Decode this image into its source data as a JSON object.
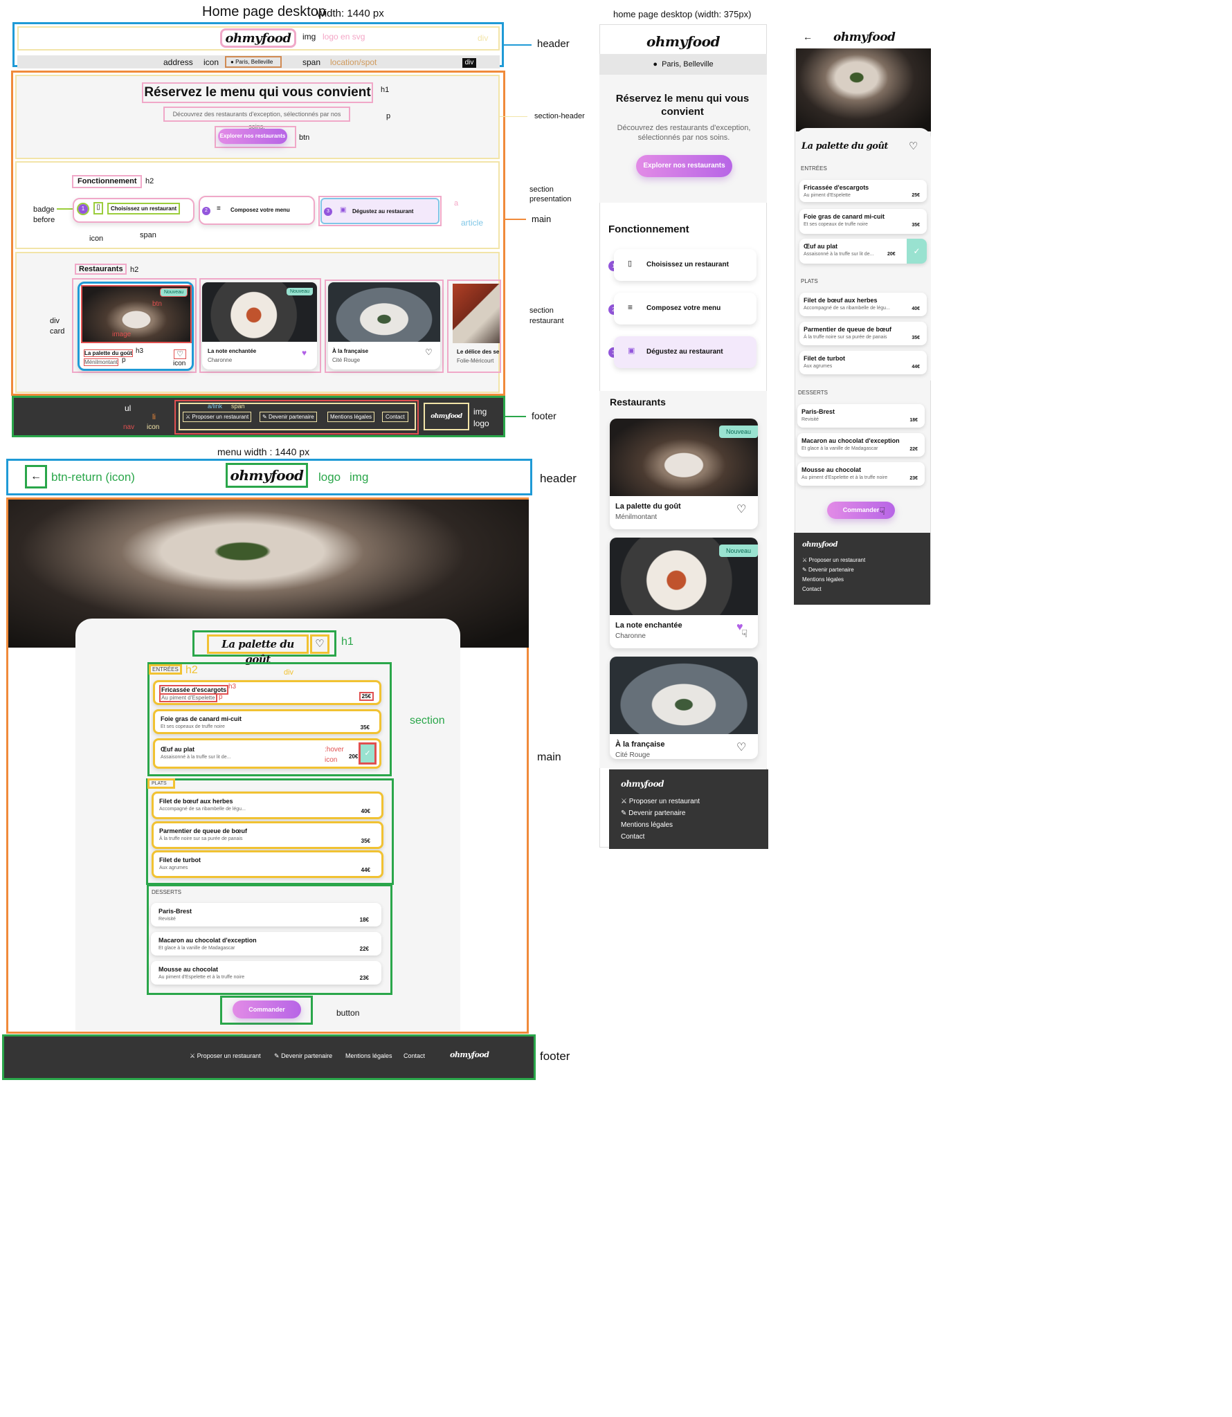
{
  "panels": {
    "home_desktop_title": "Home page desktop",
    "home_desktop_width": "width: 1440 px",
    "home_mobile_title": "home page desktop (width: 375px)",
    "menu_desktop_title": "menu width : 1440 px"
  },
  "brand": {
    "logo": "ohmyfood"
  },
  "header": {
    "location": "Paris, Belleville"
  },
  "hero": {
    "title": "Réservez le menu qui vous convient",
    "subtitle": "Découvrez des restaurants d'exception, sélectionnés par nos soins.",
    "cta": "Explorer nos restaurants"
  },
  "how": {
    "title": "Fonctionnement",
    "steps": [
      {
        "num": "1",
        "label": "Choisissez un restaurant"
      },
      {
        "num": "2",
        "label": "Composez votre menu"
      },
      {
        "num": "3",
        "label": "Dégustez au restaurant"
      }
    ]
  },
  "restaurants": {
    "title": "Restaurants",
    "new_badge": "Nouveau",
    "cards": [
      {
        "name": "La palette du goût",
        "area": "Ménilmontant"
      },
      {
        "name": "La note enchantée",
        "area": "Charonne"
      },
      {
        "name": "À la française",
        "area": "Cité Rouge"
      },
      {
        "name": "Le délice des se",
        "area": "Folie-Méricourt"
      }
    ],
    "mobile_cards": [
      {
        "name": "La palette du goût",
        "area": "Ménilmontant"
      },
      {
        "name": "La note enchantée",
        "area": "Charonne"
      },
      {
        "name": "À la française",
        "area": "Cité Rouge"
      }
    ]
  },
  "footer": {
    "links": [
      "Proposer un restaurant",
      "Devenir partenaire",
      "Mentions légales",
      "Contact"
    ]
  },
  "menu": {
    "title": "La palette du goût",
    "order": "Commander",
    "sections": [
      {
        "title": "ENTRÉES",
        "items": [
          {
            "name": "Fricassée d'escargots",
            "desc": "Au piment d'Espelette",
            "price": "25€"
          },
          {
            "name": "Foie gras de canard mi-cuit",
            "desc": "Et ses copeaux de truffe noire",
            "price": "35€"
          },
          {
            "name": "Œuf au plat",
            "desc": "Assaisonné à la truffe sur lit de...",
            "price": "20€"
          }
        ]
      },
      {
        "title": "PLATS",
        "items": [
          {
            "name": "Filet de bœuf aux herbes",
            "desc": "Accompagné de sa ribambelle de légu...",
            "price": "40€"
          },
          {
            "name": "Parmentier de queue de bœuf",
            "desc": "À la truffe noire sur sa purée de panais",
            "price": "35€"
          },
          {
            "name": "Filet de turbot",
            "desc": "Aux agrumes",
            "price": "44€"
          }
        ]
      },
      {
        "title": "DESSERTS",
        "items": [
          {
            "name": "Paris-Brest",
            "desc": "Revisité",
            "price": "18€"
          },
          {
            "name": "Macaron au chocolat d'exception",
            "desc": "Et glace à la vanille de Madagascar",
            "price": "22€"
          },
          {
            "name": "Mousse au chocolat",
            "desc": "Au piment d'Espelette et à la truffe noire",
            "price": "23€"
          }
        ]
      }
    ]
  },
  "annotations": {
    "img": "img",
    "logo_svg": "logo en svg",
    "div": "div",
    "header": "header",
    "address": "address",
    "icon": "icon",
    "span": "span",
    "location_spot": "location/spot",
    "h1": "h1",
    "p": "p",
    "btn": "btn",
    "section_header": "section-header",
    "h2": "h2",
    "badge_before": "badge\nbefore",
    "badge": "badge",
    "before": "before",
    "section_presentation_1": "section",
    "section_presentation_2": "presentation",
    "a": "a",
    "article": "article",
    "main": "main",
    "div_card_1": "div",
    "div_card_2": "card",
    "image": "image",
    "h3": "h3",
    "section_restaurant_1": "section",
    "section_restaurant_2": "restaurant",
    "ul": "ul",
    "a_link": "a/link",
    "li": "li",
    "nav": "nav",
    "logo": "logo",
    "footer": "footer",
    "btn_return": "btn-return (icon)",
    "section": "section",
    "hover": ":hover",
    "button": "button"
  }
}
